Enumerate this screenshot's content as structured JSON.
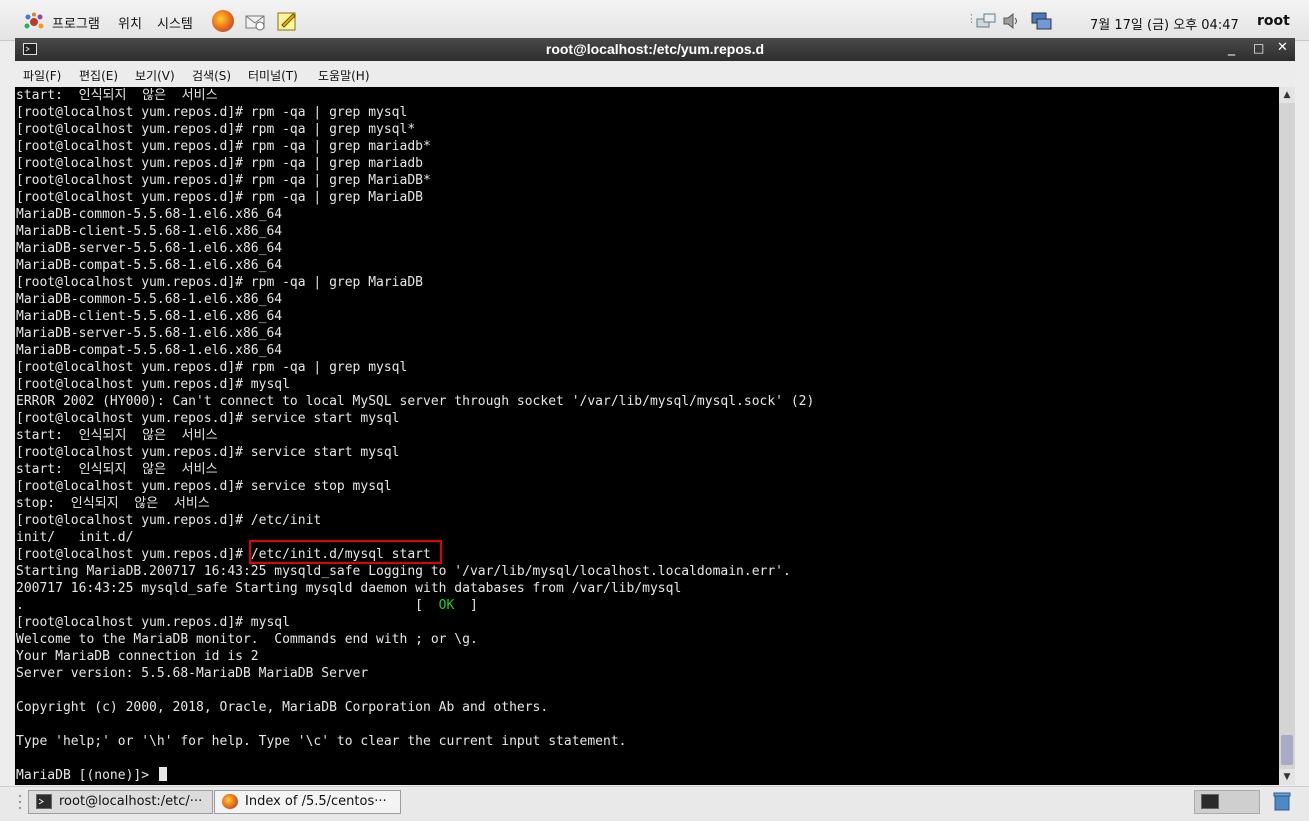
{
  "top_panel": {
    "menus": [
      "프로그램",
      "위치",
      "시스템"
    ],
    "clock": "7월 17일 (금) 오후 04:47",
    "user": "root"
  },
  "window": {
    "title": "root@localhost:/etc/yum.repos.d",
    "minimize": "_",
    "maximize": "□",
    "close": "✕"
  },
  "menubar": [
    "파일(F)",
    "편집(E)",
    "보기(V)",
    "검색(S)",
    "터미널(T)",
    "도움말(H)"
  ],
  "terminal": {
    "lines": [
      "start:  인식되지  않은  서비스",
      "[root@localhost yum.repos.d]# rpm -qa | grep mysql",
      "[root@localhost yum.repos.d]# rpm -qa | grep mysql*",
      "[root@localhost yum.repos.d]# rpm -qa | grep mariadb*",
      "[root@localhost yum.repos.d]# rpm -qa | grep mariadb",
      "[root@localhost yum.repos.d]# rpm -qa | grep MariaDB*",
      "[root@localhost yum.repos.d]# rpm -qa | grep MariaDB",
      "MariaDB-common-5.5.68-1.el6.x86_64",
      "MariaDB-client-5.5.68-1.el6.x86_64",
      "MariaDB-server-5.5.68-1.el6.x86_64",
      "MariaDB-compat-5.5.68-1.el6.x86_64",
      "[root@localhost yum.repos.d]# rpm -qa | grep MariaDB",
      "MariaDB-common-5.5.68-1.el6.x86_64",
      "MariaDB-client-5.5.68-1.el6.x86_64",
      "MariaDB-server-5.5.68-1.el6.x86_64",
      "MariaDB-compat-5.5.68-1.el6.x86_64",
      "[root@localhost yum.repos.d]# rpm -qa | grep mysql",
      "[root@localhost yum.repos.d]# mysql",
      "ERROR 2002 (HY000): Can't connect to local MySQL server through socket '/var/lib/mysql/mysql.sock' (2)",
      "[root@localhost yum.repos.d]# service start mysql",
      "start:  인식되지  않은  서비스",
      "[root@localhost yum.repos.d]# service start mysql",
      "start:  인식되지  않은  서비스",
      "[root@localhost yum.repos.d]# service stop mysql",
      "stop:  인식되지  않은  서비스",
      "[root@localhost yum.repos.d]# /etc/init",
      "init/   init.d/",
      "[root@localhost yum.repos.d]# /etc/init.d/mysql start",
      "Starting MariaDB.200717 16:43:25 mysqld_safe Logging to '/var/lib/mysql/localhost.localdomain.err'.",
      "200717 16:43:25 mysqld_safe Starting mysqld daemon with databases from /var/lib/mysql"
    ],
    "ok_line": {
      "prefix": ".                                                  [  ",
      "ok": "OK",
      "suffix": "  ]"
    },
    "lines_after": [
      "[root@localhost yum.repos.d]# mysql",
      "Welcome to the MariaDB monitor.  Commands end with ; or \\g.",
      "Your MariaDB connection id is 2",
      "Server version: 5.5.68-MariaDB MariaDB Server",
      "",
      "Copyright (c) 2000, 2018, Oracle, MariaDB Corporation Ab and others.",
      "",
      "Type 'help;' or '\\h' for help. Type '\\c' to clear the current input statement.",
      ""
    ],
    "prompt": "MariaDB [(none)]> "
  },
  "taskbar": {
    "items": [
      "root@localhost:/etc/···",
      "Index of /5.5/centos···"
    ]
  },
  "colors": {
    "terminal_bg": "#000000",
    "terminal_fg": "#e6e6e6",
    "ok_green": "#22cc22",
    "highlight_red": "#e00000"
  }
}
